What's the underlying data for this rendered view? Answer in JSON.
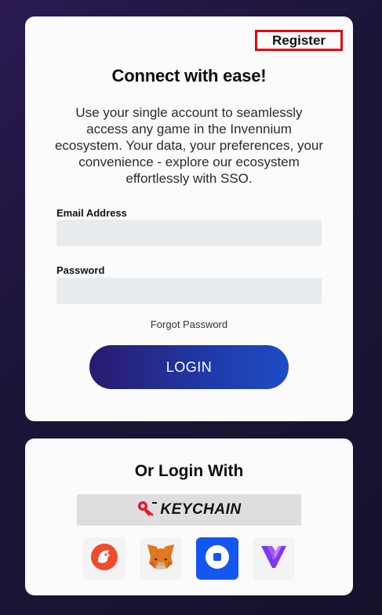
{
  "login_card": {
    "register_label": "Register",
    "title": "Connect with ease!",
    "description": "Use your single account to seamlessly access any game in the Invennium ecosystem. Your data, your preferences, your convenience - explore our ecosystem effortlessly with SSO.",
    "email_label": "Email Address",
    "email_value": "",
    "email_placeholder": "",
    "password_label": "Password",
    "password_value": "",
    "password_placeholder": "",
    "forgot_label": "Forgot Password",
    "login_label": "LOGIN"
  },
  "alt_card": {
    "title": "Or Login With",
    "keychain_label": "KEYCHAIN",
    "wallets": [
      {
        "icon": "peakd-icon"
      },
      {
        "icon": "metamask-icon"
      },
      {
        "icon": "coinbase-icon"
      },
      {
        "icon": "vsc-icon"
      }
    ]
  },
  "colors": {
    "accent_red": "#e8000e",
    "button_gradient_start": "#2a1a6e",
    "button_gradient_end": "#1d4cc6",
    "coinbase_blue": "#1456f0"
  }
}
